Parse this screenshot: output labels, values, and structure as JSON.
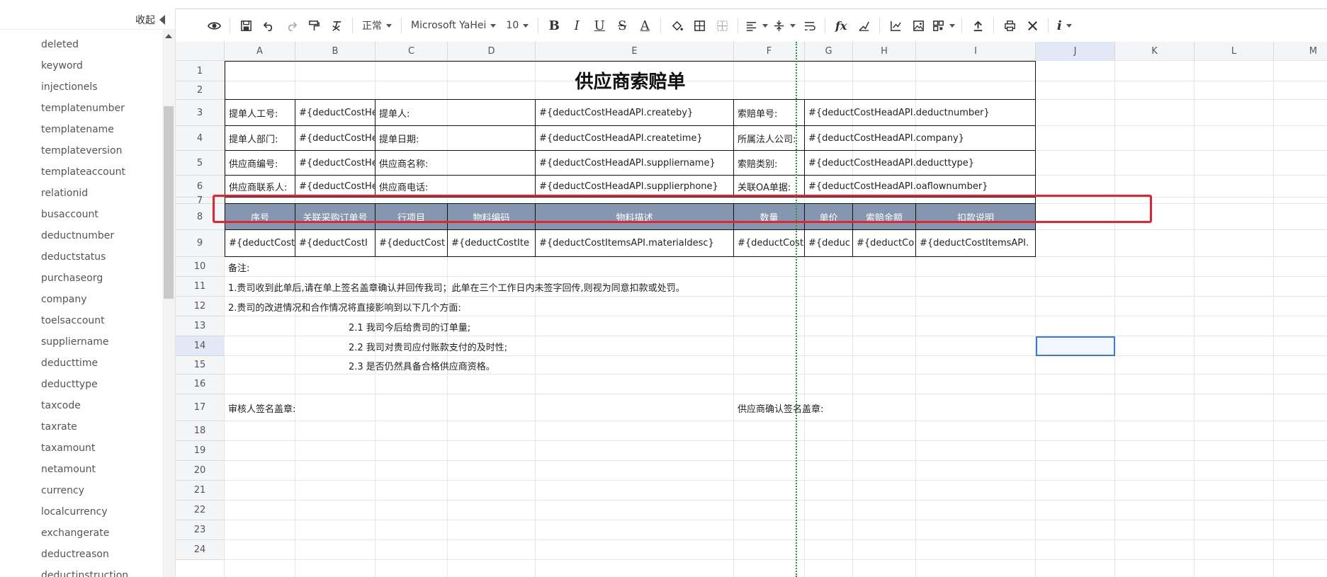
{
  "sidebar": {
    "collapse_label": "收起",
    "fields": [
      "deleted",
      "keyword",
      "injectionels",
      "templatenumber",
      "templatename",
      "templateversion",
      "templateaccount",
      "relationid",
      "busaccount",
      "deductnumber",
      "deductstatus",
      "purchaseorg",
      "company",
      "toelsaccount",
      "suppliername",
      "deducttime",
      "deducttype",
      "taxcode",
      "taxrate",
      "taxamount",
      "netamount",
      "currency",
      "localcurrency",
      "exchangerate",
      "deductreason",
      "deductinstruction"
    ]
  },
  "toolbar": {
    "style_select": "正常",
    "font_select": "Microsoft YaHei",
    "size_select": "10",
    "bold": "B",
    "italic": "I",
    "underline": "U",
    "strike": "S",
    "font_color": "A",
    "fx": "fx",
    "info": "i"
  },
  "grid": {
    "columns": [
      "A",
      "B",
      "C",
      "D",
      "E",
      "F",
      "G",
      "H",
      "I",
      "J",
      "K",
      "L",
      "M"
    ],
    "rows": [
      "1",
      "2",
      "3",
      "4",
      "5",
      "6",
      "7",
      "8",
      "9",
      "10",
      "11",
      "12",
      "13",
      "14",
      "15",
      "16",
      "17",
      "18",
      "19",
      "20",
      "21",
      "22",
      "23",
      "24"
    ],
    "selected_cell": "J14"
  },
  "sheet": {
    "title": "供应商索赔单",
    "r3": [
      "提单人工号:",
      "#{deductCostHeadAPI.workno",
      "提单人:",
      "#{deductCostHeadAPI.createby}",
      "索赔单号:",
      "#{deductCostHeadAPI.deductnumber}"
    ],
    "r4": [
      "提单人部门:",
      "#{deductCostHeadAPI.createb",
      "提单日期:",
      "#{deductCostHeadAPI.createtime}",
      "所属法人公司:",
      "#{deductCostHeadAPI.company}"
    ],
    "r5": [
      "供应商编号:",
      "#{deductCostHeadAPI.supplie",
      "供应商名称:",
      "#{deductCostHeadAPI.suppliername}",
      "索赔类别:",
      "#{deductCostHeadAPI.deducttype}"
    ],
    "r6": [
      "供应商联系人:",
      "#{deductCostHeadAPI.supplie",
      "供应商电话:",
      "#{deductCostHeadAPI.supplierphone}",
      "关联OA单据:",
      "#{deductCostHeadAPI.oaflownumber}"
    ],
    "headers": [
      "序号",
      "关联采购订单号",
      "行项目",
      "物料编码",
      "物料描述",
      "数量",
      "单价",
      "索赔金额",
      "扣款说明"
    ],
    "items": [
      "#{deductCost",
      "#{deductCostI",
      "#{deductCost",
      "#{deductCostIte",
      "#{deductCostItemsAPI.materialdesc}",
      "#{deductCost",
      "#{deduc",
      "#{deductCo",
      "#{deductCostItemsAPI."
    ],
    "remark": "备注:",
    "note1": "1.贵司收到此单后,请在单上签名盖章确认并回传我司；此单在三个工作日内未签字回传,则视为同意扣款或处罚。",
    "note2": "2.贵司的改进情况和合作情况将直接影响到以下几个方面:",
    "note21": "2.1 我司今后给贵司的订单量;",
    "note22": "2.2 我司对贵司应付账款支付的及时性;",
    "note23": "2.3 是否仍然具备合格供应商资格。",
    "reviewer_sign": "审核人签名盖章:",
    "supplier_sign": "供应商确认签名盖章:"
  },
  "colors": {
    "header_fill": "#8496b0",
    "highlight_box": "#e8232e",
    "page_break_line": "#1c9c3c",
    "selection": "#3b78e7"
  }
}
